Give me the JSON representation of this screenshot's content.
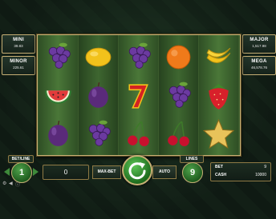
{
  "jackpots": {
    "mini": {
      "name": "MINI",
      "amount": "39.83"
    },
    "minor": {
      "name": "MINOR",
      "amount": "225.61"
    },
    "major": {
      "name": "MAJOR",
      "amount": "1,517.98"
    },
    "mega": {
      "name": "MEGA",
      "amount": "46,578.76"
    }
  },
  "reels": [
    [
      "grapes",
      "watermelon",
      "plum"
    ],
    [
      "lemon",
      "plum",
      "grapes"
    ],
    [
      "grapes",
      "seven",
      "cherries"
    ],
    [
      "orange",
      "grapes",
      "cherries"
    ],
    [
      "banana",
      "strawberry",
      "star"
    ]
  ],
  "controls": {
    "betline_label": "BET/LINE",
    "betline_value": "1",
    "win_value": "0",
    "maxbet_label": "MAX-BET",
    "auto_label": "AUTO",
    "lines_label": "LINES",
    "lines_value": "9",
    "bet_label": "BET",
    "bet_value": "9",
    "cash_label": "CASH",
    "cash_value": "10000"
  },
  "colors": {
    "accent_gold": "#c7b075",
    "button_green": "#3e8a3a"
  }
}
